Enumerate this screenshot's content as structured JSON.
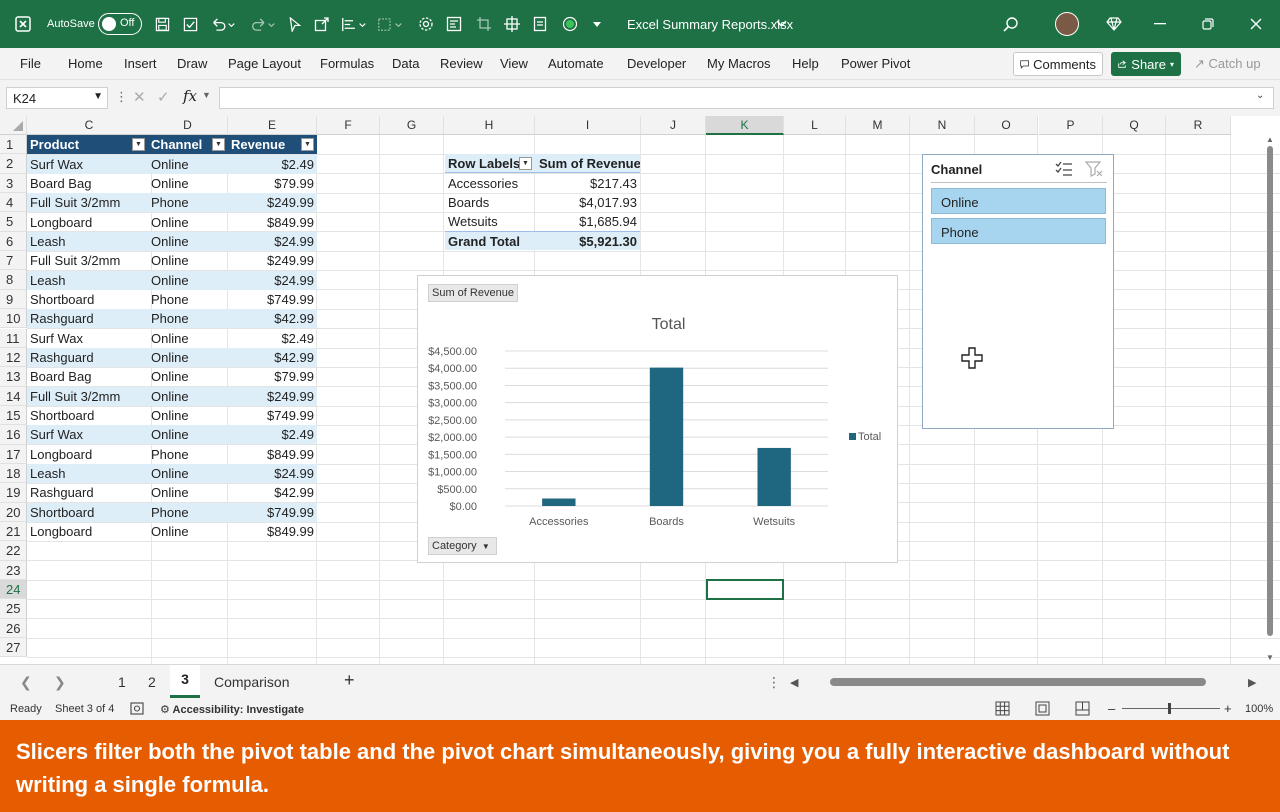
{
  "titlebar": {
    "autosave_label": "AutoSave",
    "autosave_state": "Off",
    "filename": "Excel Summary Reports.xlsx",
    "bg_color": "#1e7145"
  },
  "ribbon": {
    "tabs": [
      "File",
      "Home",
      "Insert",
      "Draw",
      "Page Layout",
      "Formulas",
      "Data",
      "Review",
      "View",
      "Automate",
      "Developer",
      "My Macros",
      "Help",
      "Power Pivot"
    ],
    "comments_label": "Comments",
    "share_label": "Share",
    "catchup_label": "Catch up"
  },
  "formula_bar": {
    "name_box": "K24",
    "fx_label": "fx",
    "content": ""
  },
  "columns": [
    "C",
    "D",
    "E",
    "F",
    "G",
    "H",
    "I",
    "J",
    "K",
    "L",
    "M",
    "N",
    "O",
    "P",
    "Q",
    "R"
  ],
  "rows": [
    "1",
    "2",
    "3",
    "4",
    "5",
    "6",
    "7",
    "8",
    "9",
    "10",
    "11",
    "12",
    "13",
    "14",
    "15",
    "16",
    "17",
    "18",
    "19",
    "20",
    "21",
    "22",
    "23",
    "24",
    "25",
    "26",
    "27"
  ],
  "table": {
    "headers": [
      "Product",
      "Channel",
      "Revenue"
    ],
    "rows": [
      [
        "Surf Wax",
        "Online",
        "$2.49"
      ],
      [
        "Board Bag",
        "Online",
        "$79.99"
      ],
      [
        "Full Suit 3/2mm",
        "Phone",
        "$249.99"
      ],
      [
        "Longboard",
        "Online",
        "$849.99"
      ],
      [
        "Leash",
        "Online",
        "$24.99"
      ],
      [
        "Full Suit 3/2mm",
        "Online",
        "$249.99"
      ],
      [
        "Leash",
        "Online",
        "$24.99"
      ],
      [
        "Shortboard",
        "Phone",
        "$749.99"
      ],
      [
        "Rashguard",
        "Phone",
        "$42.99"
      ],
      [
        "Surf Wax",
        "Online",
        "$2.49"
      ],
      [
        "Rashguard",
        "Online",
        "$42.99"
      ],
      [
        "Board Bag",
        "Online",
        "$79.99"
      ],
      [
        "Full Suit 3/2mm",
        "Online",
        "$249.99"
      ],
      [
        "Shortboard",
        "Online",
        "$749.99"
      ],
      [
        "Surf Wax",
        "Online",
        "$2.49"
      ],
      [
        "Longboard",
        "Phone",
        "$849.99"
      ],
      [
        "Leash",
        "Online",
        "$24.99"
      ],
      [
        "Rashguard",
        "Online",
        "$42.99"
      ],
      [
        "Shortboard",
        "Phone",
        "$749.99"
      ],
      [
        "Longboard",
        "Online",
        "$849.99"
      ]
    ]
  },
  "pivot": {
    "row_labels": "Row Labels",
    "sum_header": "Sum of Revenue",
    "rows": [
      [
        "Accessories",
        "$217.43"
      ],
      [
        "Boards",
        "$4,017.93"
      ],
      [
        "Wetsuits",
        "$1,685.94"
      ]
    ],
    "grand_total_label": "Grand Total",
    "grand_total_value": "$5,921.30"
  },
  "chart_data": {
    "type": "bar",
    "title": "Total",
    "field_button": "Sum of Revenue",
    "axis_button": "Category",
    "categories": [
      "Accessories",
      "Boards",
      "Wetsuits"
    ],
    "series": [
      {
        "name": "Total",
        "values": [
          217.43,
          4017.93,
          1685.94
        ]
      }
    ],
    "ylim": [
      0,
      4500
    ],
    "yticks": [
      "$0.00",
      "$500.00",
      "$1,000.00",
      "$1,500.00",
      "$2,000.00",
      "$2,500.00",
      "$3,000.00",
      "$3,500.00",
      "$4,000.00",
      "$4,500.00"
    ],
    "legend_position": "right",
    "bar_color": "#1f6680",
    "grid": true
  },
  "slicer": {
    "title": "Channel",
    "items": [
      "Online",
      "Phone"
    ],
    "item_color": "#a7d5ef"
  },
  "sheets": {
    "tabs": [
      "1",
      "2",
      "3",
      "Comparison"
    ],
    "active": "3",
    "add_label": "+"
  },
  "status": {
    "ready": "Ready",
    "sheet_info": "Sheet 3 of 4",
    "accessibility": "Accessibility: Investigate",
    "zoom": "100%"
  },
  "caption": {
    "text": "Slicers filter both the pivot table and the pivot chart simultaneously, giving you a fully interactive dashboard without writing a single formula.",
    "bg_color": "#e65c00"
  }
}
